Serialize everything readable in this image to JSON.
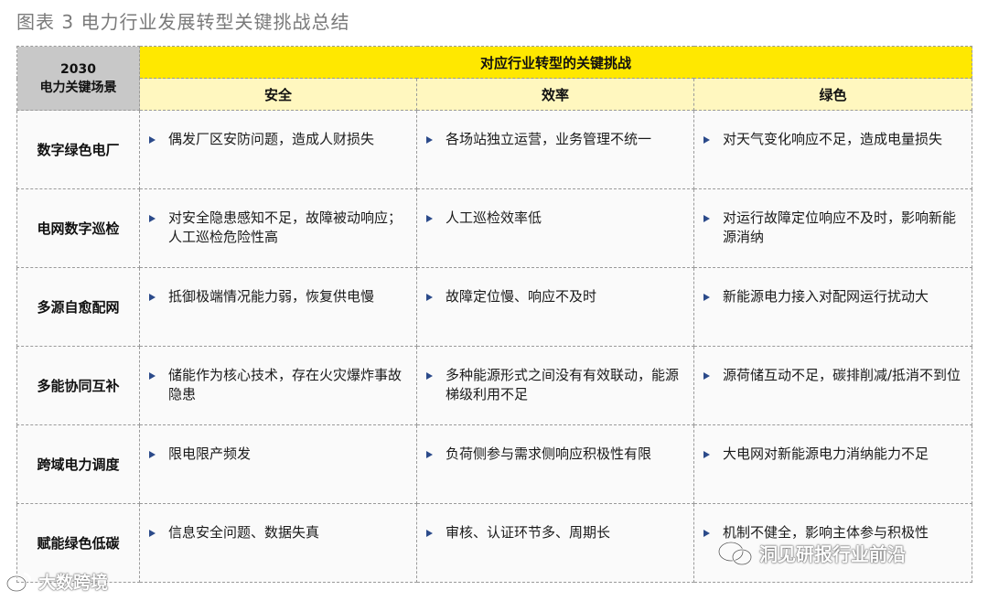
{
  "figure_title": "图表 3 电力行业发展转型关键挑战总结",
  "table": {
    "corner_line1": "2030",
    "corner_line2": "电力关键场景",
    "super_header": "对应行业转型的关键挑战",
    "columns": [
      "安全",
      "效率",
      "绿色"
    ],
    "rows": [
      {
        "scenario": "数字绿色电厂",
        "cells": [
          "偶发厂区安防问题，造成人财损失",
          "各场站独立运营，业务管理不统一",
          "对天气变化响应不足，造成电量损失"
        ]
      },
      {
        "scenario": "电网数字巡检",
        "cells": [
          "对安全隐患感知不足，故障被动响应；人工巡检危险性高",
          "人工巡检效率低",
          "对运行故障定位响应不及时，影响新能源消纳"
        ]
      },
      {
        "scenario": "多源自愈配网",
        "cells": [
          "抵御极端情况能力弱，恢复供电慢",
          "故障定位慢、响应不及时",
          "新能源电力接入对配网运行扰动大"
        ]
      },
      {
        "scenario": "多能协同互补",
        "cells": [
          "储能作为核心技术，存在火灾爆炸事故隐患",
          "多种能源形式之间没有有效联动，能源梯级利用不足",
          "源荷储互动不足，碳排削减/抵消不到位"
        ]
      },
      {
        "scenario": "跨域电力调度",
        "cells": [
          "限电限产频发",
          "负荷侧参与需求侧响应积极性有限",
          "大电网对新能源电力消纳能力不足"
        ]
      },
      {
        "scenario": "赋能绿色低碳",
        "cells": [
          "信息安全问题、数据失真",
          "审核、认证环节多、周期长",
          "机制不健全，影响主体参与积极性"
        ]
      }
    ]
  },
  "watermarks": {
    "left": "大数跨境",
    "right": "洞见研报行业前沿"
  },
  "colors": {
    "super_header_bg": "#ffe800",
    "column_header_bg": "#fff7bf",
    "corner_bg": "#c8c8c8",
    "bullet": "#2b4a8a"
  }
}
